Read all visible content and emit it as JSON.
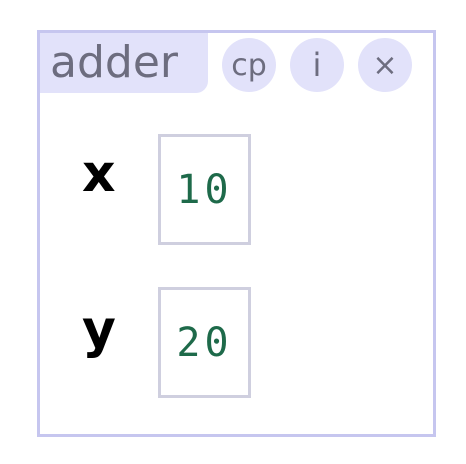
{
  "node": {
    "title": "adder",
    "buttons": {
      "copy": "cp",
      "info": "i",
      "close": "×"
    },
    "fields": [
      {
        "label": "x",
        "value": "10"
      },
      {
        "label": "y",
        "value": "20"
      }
    ]
  },
  "colors": {
    "border": "#c6c6ef",
    "tab_background": "#e2e2fa",
    "muted_text": "#6d6d7f",
    "value_text": "#1e6a4a",
    "field_border": "#cfcfdf"
  }
}
